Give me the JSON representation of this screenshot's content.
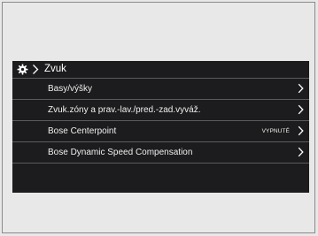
{
  "header": {
    "icon": "gear-icon",
    "title": "Zvuk"
  },
  "menu": {
    "items": [
      {
        "label": "Basy/výšky",
        "value": ""
      },
      {
        "label": "Zvuk.zóny a prav.-lav./pred.-zad.vyváž.",
        "value": ""
      },
      {
        "label": "Bose Centerpoint",
        "value": "VYPNUTÉ"
      },
      {
        "label": "Bose Dynamic Speed Compensation",
        "value": ""
      }
    ]
  },
  "colors": {
    "screen_background": "#1c1c1e",
    "divider": "#5b5b5e",
    "text": "#f0f0f0"
  }
}
